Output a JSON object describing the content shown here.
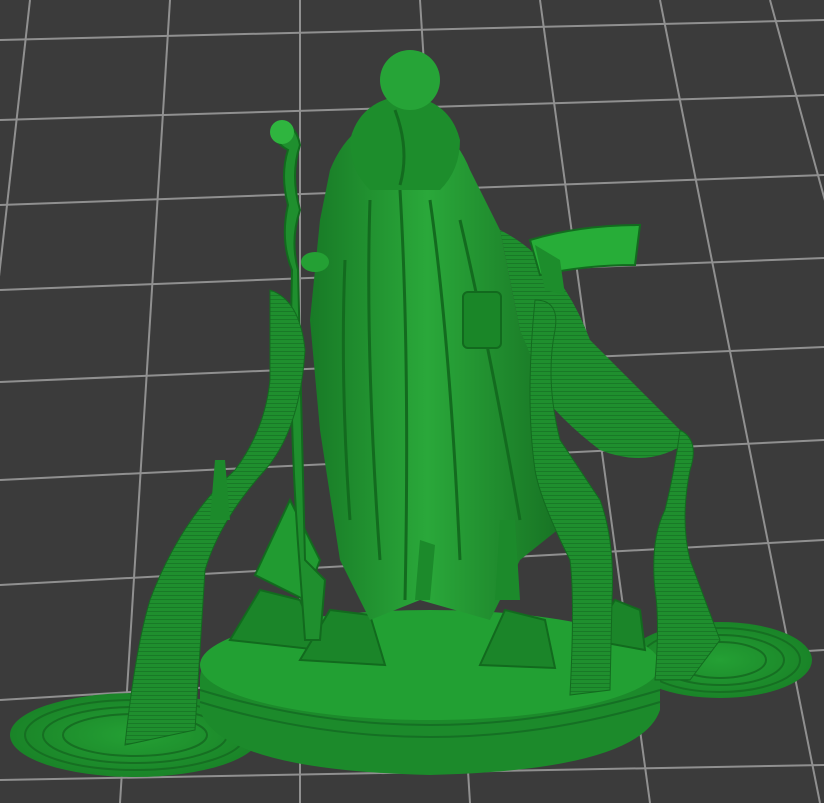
{
  "app": {
    "view": "slicer-3d-preview"
  },
  "scene": {
    "background_color": "#3b3b3b",
    "grid_line_color": "#9a9a9a",
    "model": {
      "subject": "wizard-miniature-with-staff-and-book",
      "color_main": "#1f8f2e",
      "color_light": "#2fb53f",
      "color_dark": "#136b1f",
      "has_base": true,
      "support_count": 3
    }
  }
}
